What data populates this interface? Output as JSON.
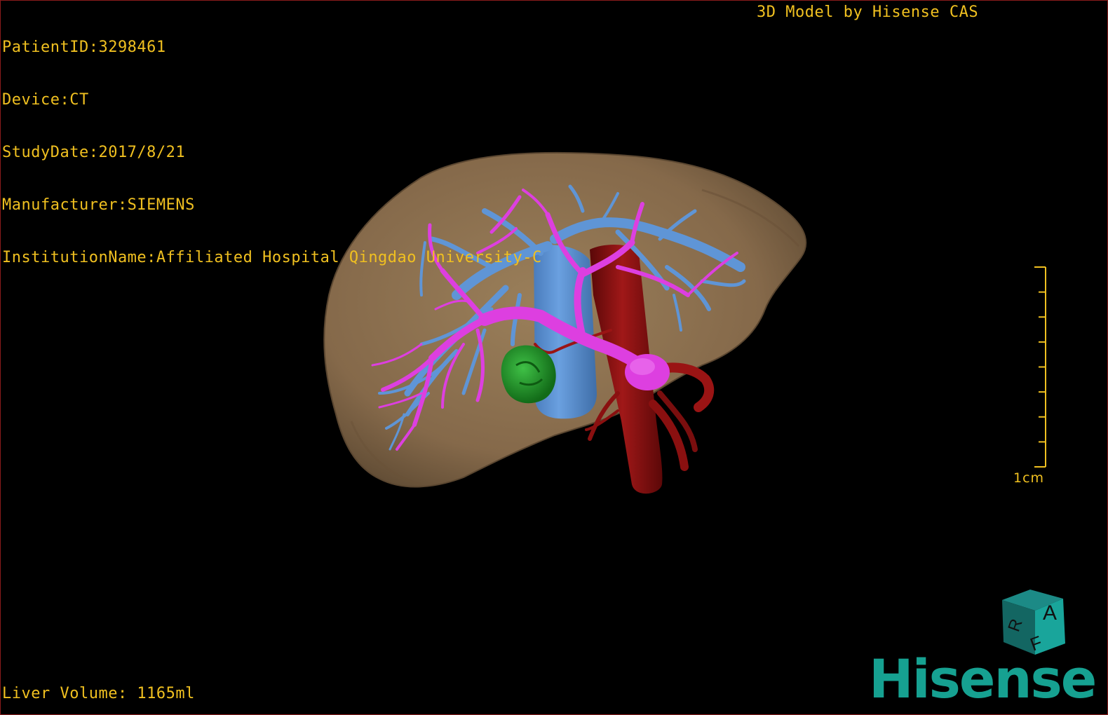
{
  "patient_info": {
    "patient_id": "PatientID:3298461",
    "device": "Device:CT",
    "study_date": "StudyDate:2017/8/21",
    "manufacturer": "Manufacturer:SIEMENS",
    "institution": "InstitutionName:Affiliated Hospital Qingdao University-C"
  },
  "model_credit": "3D Model by Hisense CAS",
  "liver_volume": "Liver Volume: 1165ml",
  "scale_bar": {
    "label": "1cm",
    "tick_count": 9
  },
  "orientation_cube": {
    "face_top": "A",
    "face_front": "F",
    "face_left": "R"
  },
  "brand": {
    "name": "Hisense",
    "color": "#16a191"
  },
  "colors": {
    "overlay_text": "#f0c020",
    "liver": "#8b7352",
    "portal_vein": "#dd3fe0",
    "hepatic_vein": "#5f95d6",
    "ivc": "#5b8fd0",
    "artery": "#8a0f0f",
    "lesion": "#1f9a28"
  }
}
